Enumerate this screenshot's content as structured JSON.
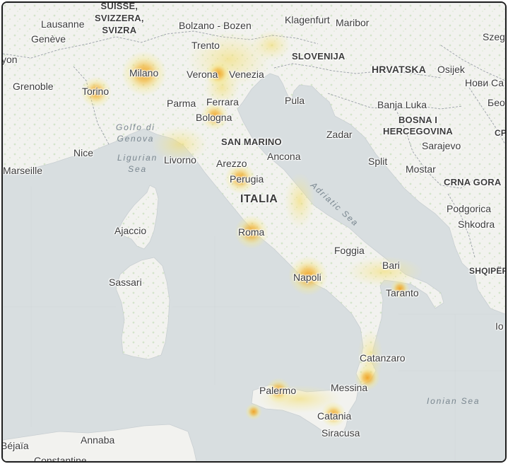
{
  "map": {
    "colors": {
      "sea": "#d8dee0",
      "land": "#f2f2ef",
      "vegetation": "#cfe3c4",
      "borders": "#9aa0a8",
      "hotspot_core": "#f0a020",
      "hotspot_glow": "#f5e98a",
      "label_text": "#3a3a3a",
      "sea_label": "#7a8790"
    },
    "heat_layer": "outage-intensity-hotspots",
    "countries": {
      "switzerland_1": "SUISSE,",
      "switzerland_2": "SVIZZERA,",
      "switzerland_3": "SVIZRA",
      "slovenia": "SLOVENIJA",
      "croatia": "HRVATSKA",
      "bosnia_1": "BOSNA I",
      "bosnia_2": "HERCEGOVINA",
      "san_marino": "SAN MARINO",
      "italy": "ITALIA",
      "montenegro": "CRNA GORA",
      "albania": "SHQIPËR",
      "serbia_partial": "СР"
    },
    "seas": {
      "ligurian_1": "Ligurian",
      "ligurian_2": "Sea",
      "genova_gulf_1": "Golfo di",
      "genova_gulf_2": "Genova",
      "adriatic": "Adriatic Sea",
      "ionian": "Ionian Sea"
    },
    "cities": {
      "lausanne": "Lausanne",
      "geneve": "Genève",
      "lyon_partial": "yon",
      "grenoble": "Grenoble",
      "torino": "Torino",
      "milano": "Milano",
      "bolzano": "Bolzano - Bozen",
      "trento": "Trento",
      "klagenfurt": "Klagenfurt",
      "maribor": "Maribor",
      "szeged_partial": "Szeg",
      "verona": "Verona",
      "venezia": "Venezia",
      "parma": "Parma",
      "ferrara": "Ferrara",
      "bologna": "Bologna",
      "osijek": "Osijek",
      "novi_sad_partial": "Нови Са",
      "belgrade_partial": "Бео",
      "banja_luka": "Banja Luka",
      "pula": "Pula",
      "zadar": "Zadar",
      "sarajevo": "Sarajevo",
      "split": "Split",
      "mostar": "Mostar",
      "nice": "Nice",
      "marseille": "Marseille",
      "livorno": "Livorno",
      "arezzo": "Arezzo",
      "ancona": "Ancona",
      "perugia": "Perugia",
      "podgorica": "Podgorica",
      "shkodra": "Shkodra",
      "ajaccio": "Ajaccio",
      "roma": "Roma",
      "foggia": "Foggia",
      "bari": "Bari",
      "sassari": "Sassari",
      "napoli": "Napoli",
      "taranto": "Taranto",
      "ionian_partial": "Io",
      "catanzaro": "Catanzaro",
      "messina": "Messina",
      "palermo": "Palermo",
      "catania": "Catania",
      "siracusa": "Siracusa",
      "annaba": "Annaba",
      "bejaia": "Béjaïa",
      "constantine": "Constantine"
    }
  }
}
